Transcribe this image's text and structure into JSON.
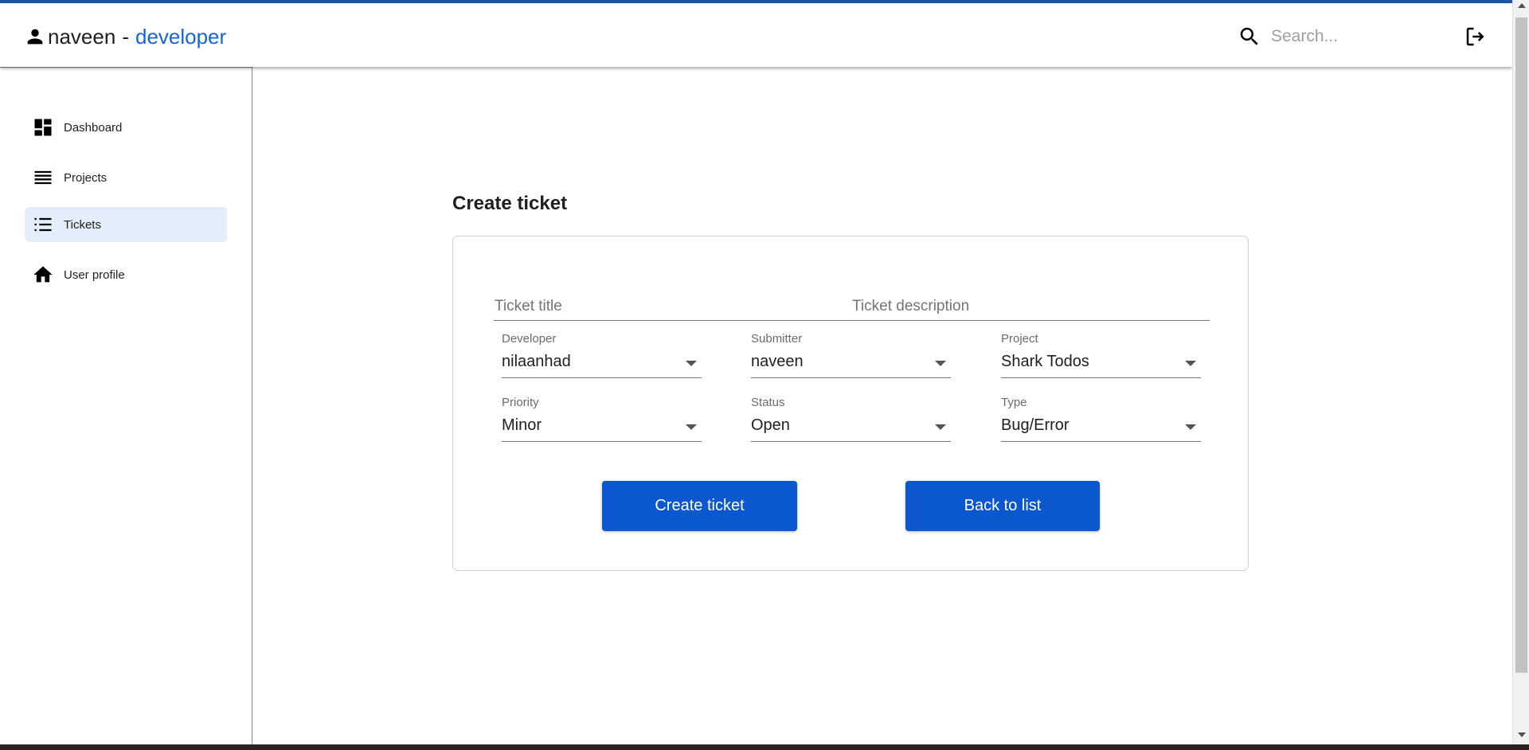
{
  "header": {
    "username": "naveen",
    "separator": "-",
    "role": "developer",
    "search_placeholder": "Search...",
    "accent_color": "#1565d8"
  },
  "sidebar": {
    "items": [
      {
        "label": "Dashboard",
        "icon": "dashboard-icon"
      },
      {
        "label": "Projects",
        "icon": "list-lines-icon"
      },
      {
        "label": "Tickets",
        "icon": "bulleted-list-icon",
        "active": true
      },
      {
        "label": "User profile",
        "icon": "home-icon"
      }
    ]
  },
  "main": {
    "title": "Create ticket",
    "form": {
      "title_placeholder": "Ticket title",
      "description_placeholder": "Ticket description",
      "selects": [
        {
          "label": "Developer",
          "value": "nilaanhad"
        },
        {
          "label": "Submitter",
          "value": "naveen"
        },
        {
          "label": "Project",
          "value": "Shark Todos"
        },
        {
          "label": "Priority",
          "value": "Minor"
        },
        {
          "label": "Status",
          "value": "Open"
        },
        {
          "label": "Type",
          "value": "Bug/Error"
        }
      ],
      "create_button": "Create ticket",
      "back_button": "Back to list",
      "button_color": "#0b57d0"
    }
  }
}
